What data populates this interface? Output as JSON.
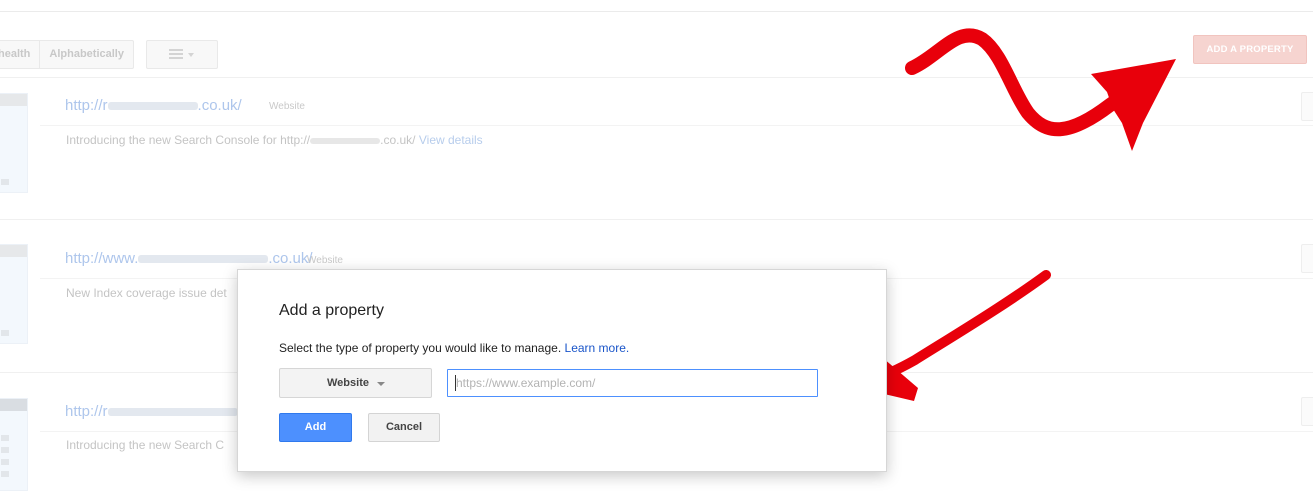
{
  "toolbar": {
    "sort_health_label": "health",
    "sort_alpha_label": "Alphabetically",
    "add_property_label": "ADD A PROPERTY"
  },
  "properties": [
    {
      "url_prefix": "http://r",
      "url_suffix": ".co.uk/",
      "type": "Website",
      "message_prefix": "Introducing the new Search Console for http://",
      "message_suffix": ".co.uk/",
      "message_link": "View details"
    },
    {
      "url_prefix": "http://www.",
      "url_suffix": ".co.uk/",
      "type": "Website",
      "message_prefix": "New Index coverage issue det"
    },
    {
      "url_prefix": "http://r",
      "message_prefix": "Introducing the new Search C"
    }
  ],
  "dialog": {
    "title": "Add a property",
    "description": "Select the type of property you would like to manage.",
    "learn_more": "Learn more.",
    "type_select": "Website",
    "url_placeholder": "https://www.example.com/",
    "add_label": "Add",
    "cancel_label": "Cancel"
  },
  "colors": {
    "annotation_arrow": "#e8000b",
    "primary_button": "#4d90fe",
    "link": "#1a55c9"
  }
}
